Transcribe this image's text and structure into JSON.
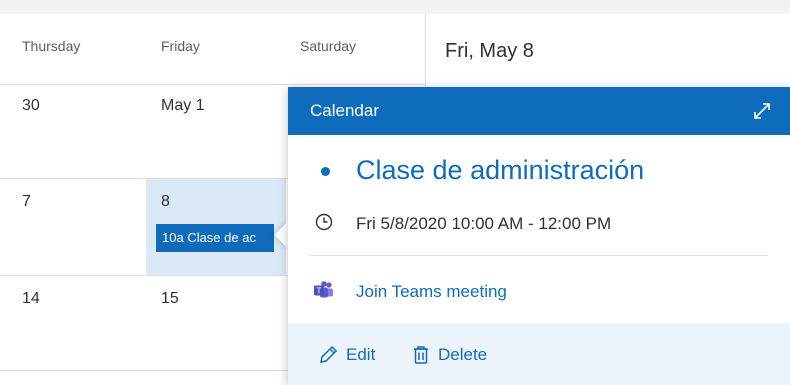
{
  "calendar": {
    "day_headers": [
      "Thursday",
      "Friday",
      "Saturday"
    ],
    "rows": [
      [
        "30",
        "May 1",
        ""
      ],
      [
        "7",
        "8",
        ""
      ],
      [
        "14",
        "15",
        ""
      ]
    ],
    "event_chip": "10a Clase de ac"
  },
  "right_panel": {
    "date": "Fri, May 8"
  },
  "popup": {
    "header": "Calendar",
    "event_title": "Clase de administración",
    "time": "Fri 5/8/2020 10:00 AM - 12:00 PM",
    "teams_link": "Join Teams meeting",
    "edit_label": "Edit",
    "delete_label": "Delete",
    "accent": "#0f6cbd"
  }
}
